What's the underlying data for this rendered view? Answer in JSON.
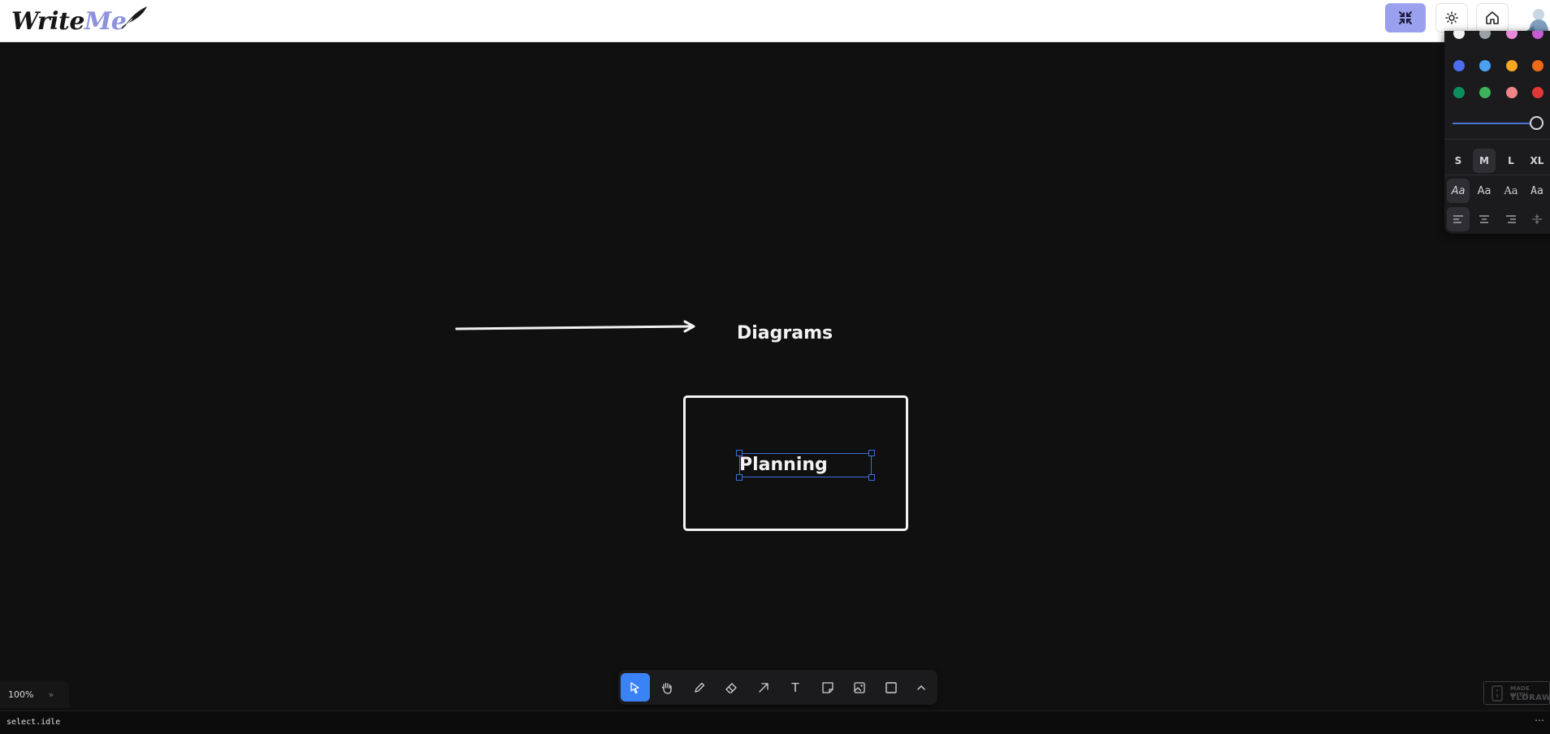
{
  "app": {
    "logo_text_write": "Write",
    "logo_text_me": "Me"
  },
  "header": {
    "exit_focus_icon": "collapse-arrows-icon",
    "theme_icon": "sun-icon",
    "home_icon": "home-icon",
    "avatar_icon": "avatar-illustration"
  },
  "style_panel": {
    "colors": [
      "#f2f2f2",
      "#9aa0a6",
      "#e88ad9",
      "#c85bd1",
      "#4a6cf0",
      "#4ba1f0",
      "#f5a623",
      "#ee6a19",
      "#0c8f5a",
      "#3fb25d",
      "#f08589",
      "#e03838"
    ],
    "opacity": 1.0,
    "sizes": [
      "S",
      "M",
      "L",
      "XL"
    ],
    "selected_size": "M",
    "fonts": [
      "Aa",
      "Aa",
      "Aa",
      "Aa"
    ],
    "align_icons": [
      "align-left-icon",
      "align-center-icon",
      "align-right-icon",
      "vertical-align-icon"
    ]
  },
  "canvas": {
    "diagrams_label": "Diagrams",
    "planning_label": "Planning"
  },
  "toolbar": {
    "tools": [
      "select-tool",
      "hand-tool",
      "draw-tool",
      "eraser-tool",
      "arrow-tool",
      "text-tool",
      "note-tool",
      "media-tool",
      "rectangle-tool",
      "more-tools"
    ],
    "active_tool": "select-tool",
    "text_glyph": "T"
  },
  "zoom": {
    "label": "100%",
    "chevron": "»"
  },
  "status": {
    "text": "select.idle",
    "more": "⋯"
  },
  "badge": {
    "made_with": "MADE WITH",
    "tldraw": "TLDRAW"
  }
}
